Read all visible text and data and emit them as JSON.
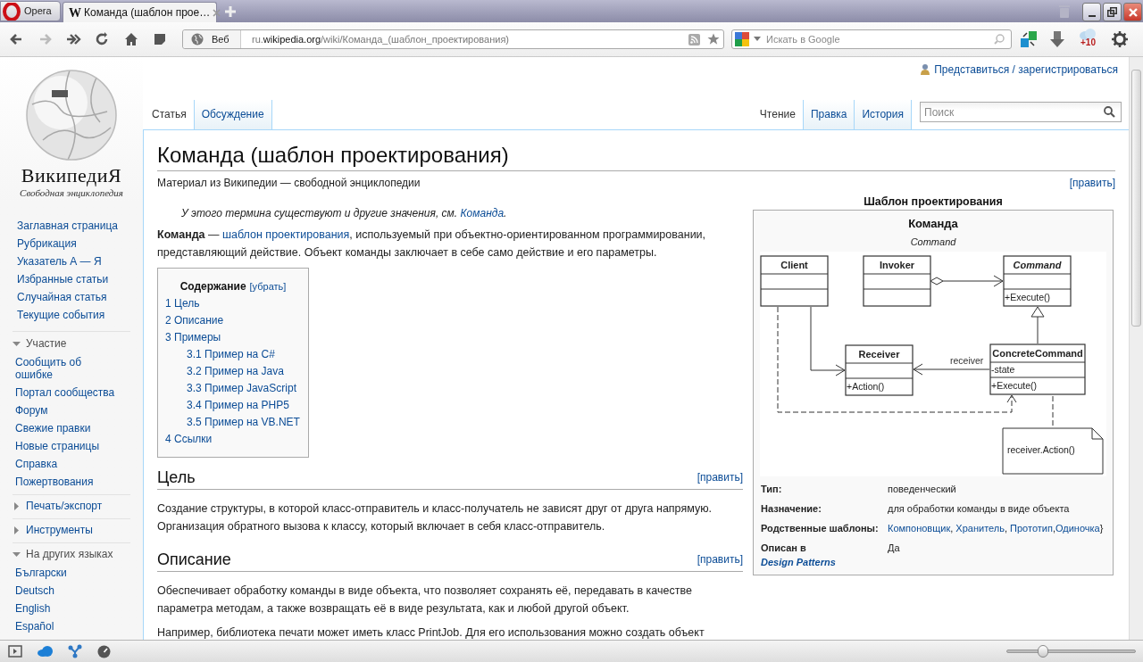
{
  "browser": {
    "menu_button": "Opera",
    "tabs": [
      {
        "favicon": "W",
        "title": "Команда (шаблон прое…",
        "selected": true
      }
    ],
    "address": {
      "mode": "Веб",
      "host_prefix": "ru.",
      "domain": "wikipedia.org",
      "path": "/wiki/Команда_(шаблон_проектирования)"
    },
    "search": {
      "placeholder": "Искать в Google"
    },
    "weather_badge": "+10"
  },
  "page": {
    "user_link": "Представиться / зарегистрироваться",
    "logo": {
      "wordmark": "ВикипедиЯ",
      "tagline": "Свободная энциклопедия"
    },
    "sidebar": {
      "nav": [
        "Заглавная страница",
        "Рубрикация",
        "Указатель А — Я",
        "Избранные статьи",
        "Случайная статья",
        "Текущие события"
      ],
      "sections": [
        {
          "title": "Участие",
          "expanded": true,
          "items": [
            "Сообщить об ошибке",
            "Портал сообщества",
            "Форум",
            "Свежие правки",
            "Новые страницы",
            "Справка",
            "Пожертвования"
          ]
        },
        {
          "title": "Печать/экспорт",
          "expanded": false
        },
        {
          "title": "Инструменты",
          "expanded": false
        },
        {
          "title": "На других языках",
          "expanded": true,
          "items": [
            "Български",
            "Deutsch",
            "English",
            "Español"
          ]
        }
      ]
    },
    "namespace_tabs": [
      {
        "label": "Статья",
        "selected": true
      },
      {
        "label": "Обсуждение",
        "selected": false
      }
    ],
    "view_tabs": [
      {
        "label": "Чтение",
        "selected": true
      },
      {
        "label": "Правка",
        "selected": false
      },
      {
        "label": "История",
        "selected": false
      }
    ],
    "search": {
      "placeholder": "Поиск"
    },
    "article": {
      "title": "Команда (шаблон проектирования)",
      "subtitle": "Материал из Википедии — свободной энциклопедии",
      "edit": "[править]",
      "hatnote": {
        "text": "У этого термина существуют и другие значения, см. ",
        "link": "Команда",
        "tail": "."
      },
      "intro": {
        "lead": "**Команда** — ",
        "link": "шаблон проектирования",
        "rest": ", используемый при объектно-ориентированном программировании, представляющий действие. Объект команды заключает в себе само действие и его параметры."
      },
      "toc": {
        "title": "Содержание",
        "toggle": "[убрать]",
        "items": [
          {
            "label": "1 Цель"
          },
          {
            "label": "2 Описание"
          },
          {
            "label": "3 Примеры",
            "children": [
              {
                "label": "3.1 Пример на C#"
              },
              {
                "label": "3.2 Пример на Java"
              },
              {
                "label": "3.3 Пример JavaScript"
              },
              {
                "label": "3.4 Пример на PHP5"
              },
              {
                "label": "3.5 Пример на VB.NET"
              }
            ]
          },
          {
            "label": "4 Ссылки"
          }
        ]
      },
      "sections": [
        {
          "heading": "Цель",
          "edit": "[править]",
          "paragraphs": [
            "Создание структуры, в которой класс-отправитель и класс-получатель не зависят друг от друга напрямую. Организация обратного вызова к классу, который включает в себя класс-отправитель."
          ]
        },
        {
          "heading": "Описание",
          "edit": "[править]",
          "paragraphs": [
            "Обеспечивает обработку команды в виде объекта, что позволяет сохранять её, передавать в качестве параметра методам, а также возвращать её в виде результата, как и любой другой объект.",
            "Например, библиотека печати может иметь класс PrintJob. Для его использования можно создать объект"
          ]
        }
      ]
    },
    "infobox": {
      "caption": "Шаблон проектирования",
      "name": "Команда",
      "english": "Command",
      "diagram": {
        "classes": [
          {
            "name": "Client",
            "abstract": false
          },
          {
            "name": "Invoker",
            "abstract": false
          },
          {
            "name": "Command",
            "abstract": true,
            "methods": [
              "+Execute()"
            ]
          },
          {
            "name": "Receiver",
            "abstract": false,
            "methods": [
              "+Action()"
            ]
          },
          {
            "name": "ConcreteCommand",
            "abstract": false,
            "attributes": [
              "-state"
            ],
            "methods": [
              "+Execute()"
            ]
          }
        ],
        "association_label": "receiver",
        "note": "receiver.Action()"
      },
      "rows": [
        {
          "label": "Тип:",
          "value": "поведенческий"
        },
        {
          "label": "Назначение:",
          "value": "для обработки команды в виде объекта"
        },
        {
          "label": "Родственные шаблоны:",
          "links": [
            {
              "text": "Компоновщик",
              "after": ", "
            },
            {
              "text": "Хранитель",
              "after": ", "
            },
            {
              "text": "Прототип",
              "after": ","
            },
            {
              "text": "Одиночка",
              "after": "}"
            }
          ]
        },
        {
          "label": "Описан в",
          "label_link": "Design Patterns",
          "value": "Да"
        }
      ]
    }
  },
  "status_bar": {
    "zoom": {
      "level": 0.28
    }
  }
}
